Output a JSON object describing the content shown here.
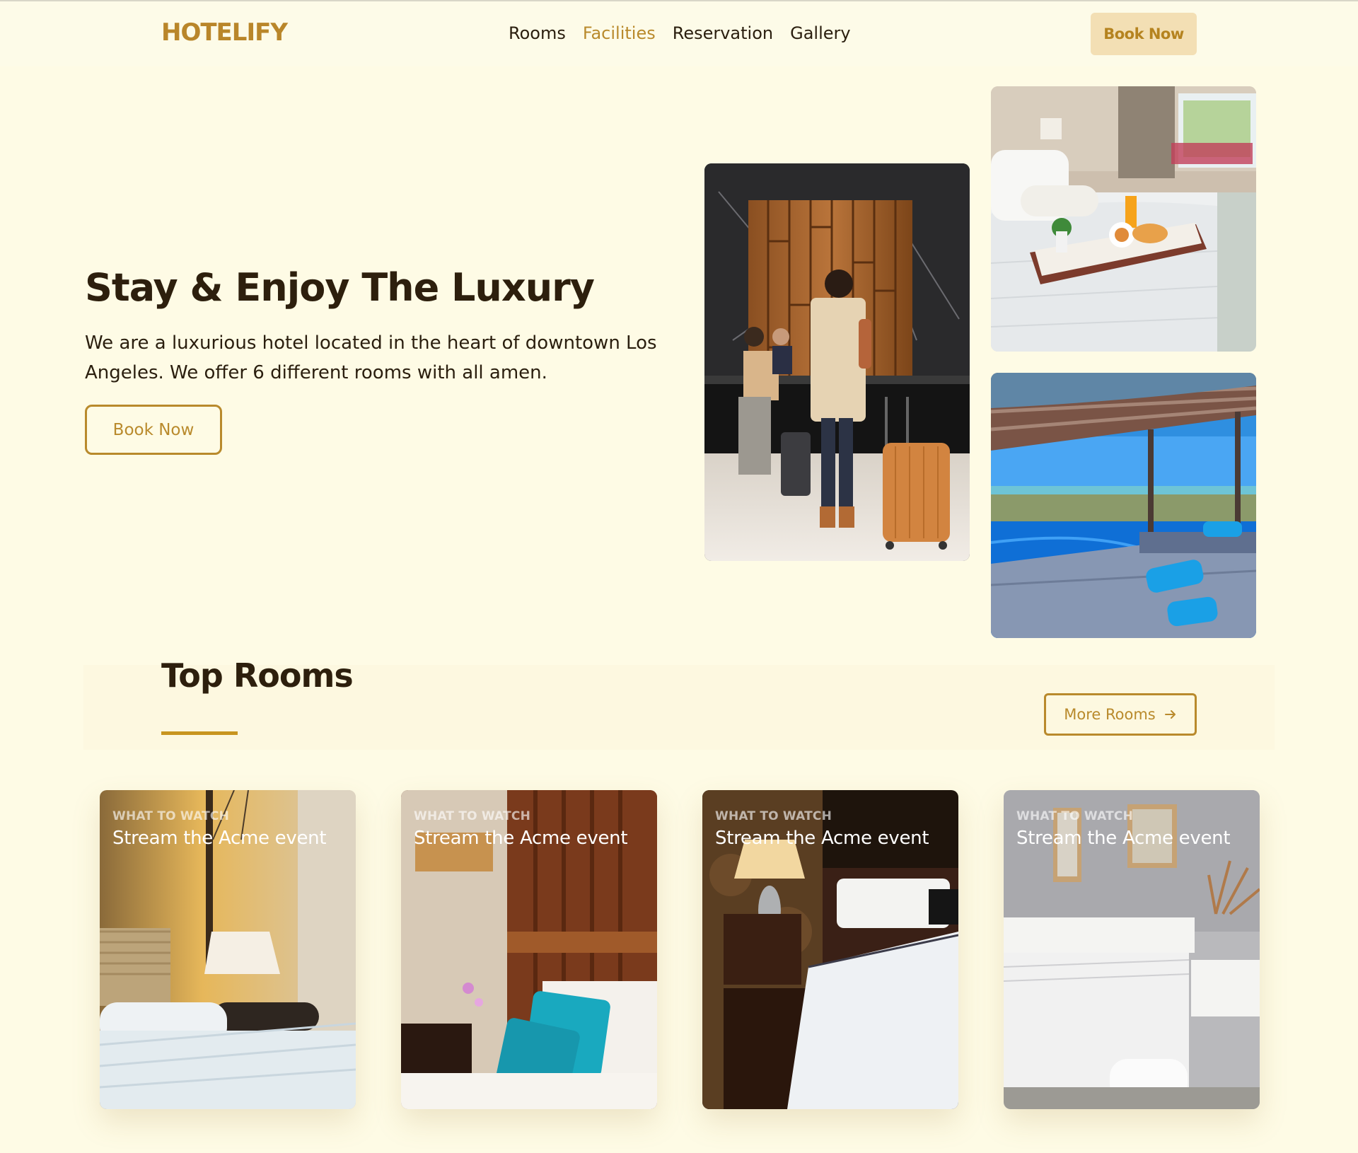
{
  "brand": {
    "logo": "HOTELIFY",
    "accent": "#b98a2c",
    "background": "#fefbe5"
  },
  "nav": {
    "links": [
      {
        "label": "Rooms",
        "active": false
      },
      {
        "label": "Facilities",
        "active": true
      },
      {
        "label": "Reservation",
        "active": false
      },
      {
        "label": "Gallery",
        "active": false
      }
    ],
    "cta": "Book Now"
  },
  "hero": {
    "title": "Stay & Enjoy The Luxury",
    "description": "We are a luxurious hotel located in the heart of downtown Los Angeles. We offer 6 different rooms with all amen.",
    "cta": "Book Now",
    "images": [
      {
        "name": "reception-photo"
      },
      {
        "name": "breakfast-in-bed-photo"
      },
      {
        "name": "pool-cabana-photo"
      }
    ]
  },
  "top_rooms": {
    "title": "Top Rooms",
    "more_button": "More Rooms",
    "more_icon": "arrow-right-icon",
    "cards": [
      {
        "eyebrow": "WHAT TO WATCH",
        "title": "Stream the Acme event"
      },
      {
        "eyebrow": "WHAT TO WATCH",
        "title": "Stream the Acme event"
      },
      {
        "eyebrow": "WHAT TO WATCH",
        "title": "Stream the Acme event"
      },
      {
        "eyebrow": "WHAT TO WATCH",
        "title": "Stream the Acme event"
      }
    ]
  }
}
